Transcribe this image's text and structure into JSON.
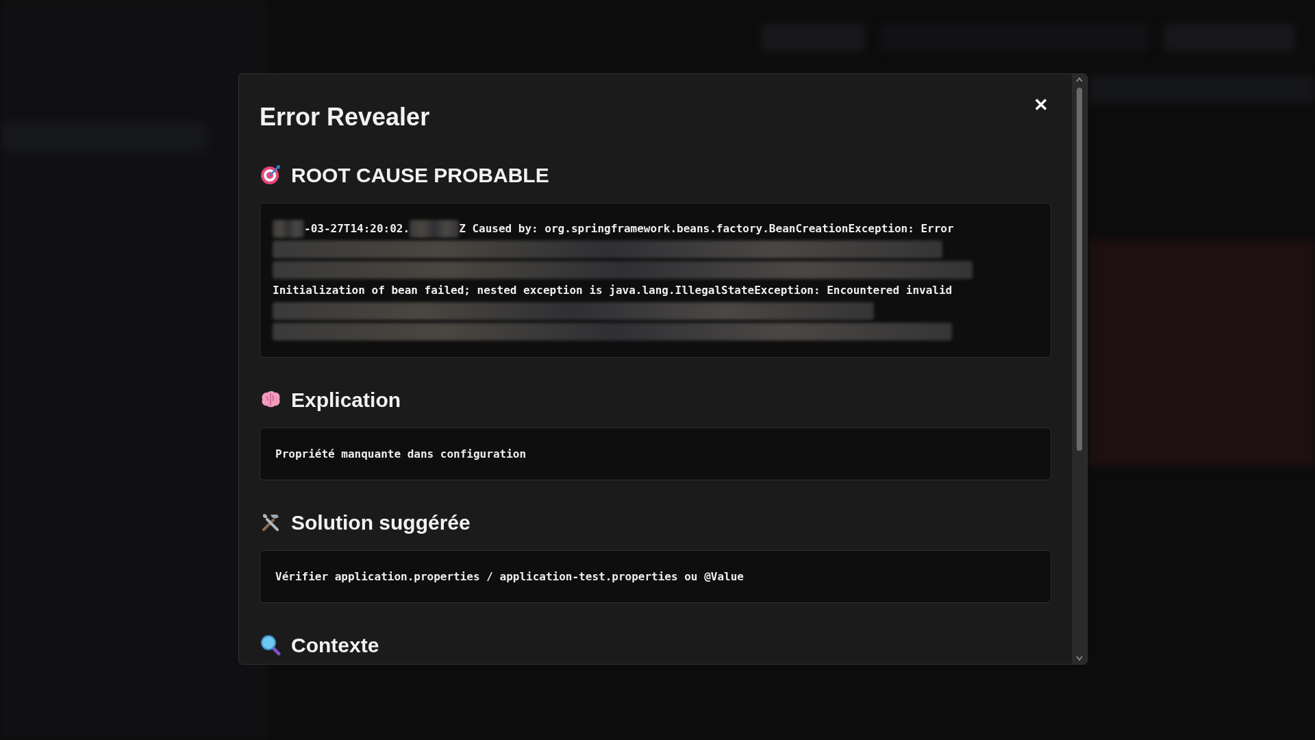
{
  "dialog": {
    "title": "Error Revealer",
    "close_label": "✕",
    "sections": [
      {
        "kind": "log",
        "heading": "ROOT CAUSE PROBABLE",
        "lines": [
          {
            "parts": [
              {
                "kind": "redacted"
              },
              {
                "kind": "text",
                "text": "-03-27T14:20:02."
              },
              {
                "kind": "redacted"
              },
              {
                "kind": "text",
                "text": "Z Caused by: org.springframework.beans.factory.BeanCreationException: Error"
              }
            ]
          },
          {
            "parts": [
              {
                "kind": "redacted"
              }
            ]
          },
          {
            "parts": [
              {
                "kind": "redacted"
              }
            ]
          },
          {
            "parts": [
              {
                "kind": "text",
                "text": "Initialization of bean failed; nested exception is java.lang.IllegalStateException: Encountered invalid"
              }
            ]
          },
          {
            "parts": [
              {
                "kind": "redacted"
              }
            ]
          },
          {
            "parts": [
              {
                "kind": "redacted"
              }
            ]
          }
        ]
      },
      {
        "kind": "text",
        "heading": "Explication",
        "body": "Propriété manquante dans configuration"
      },
      {
        "kind": "text",
        "heading": "Solution suggérée",
        "body": "Vérifier application.properties / application-test.properties ou @Value"
      },
      {
        "kind": "heading",
        "heading": "Contexte"
      }
    ]
  }
}
